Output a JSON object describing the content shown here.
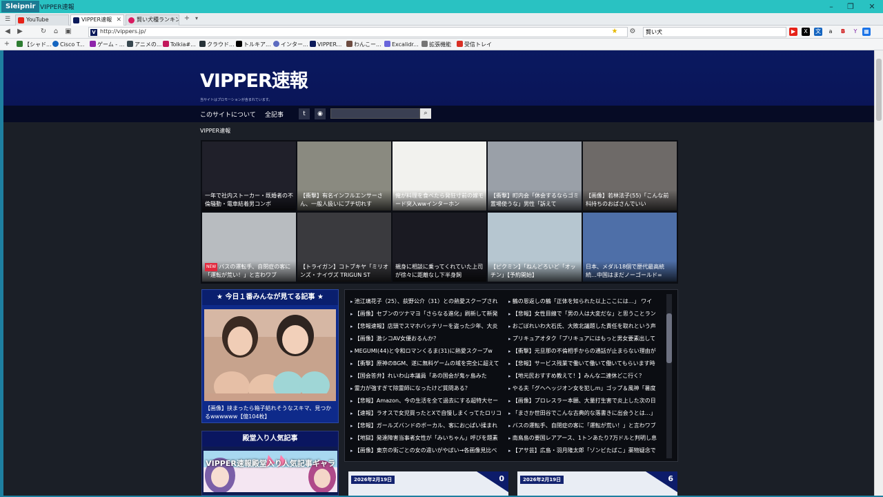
{
  "window": {
    "app_name": "Sleipnir",
    "title": "VIPPER速報"
  },
  "tabs": [
    {
      "label": "YouTube",
      "color": "#e62117"
    },
    {
      "label": "VIPPER速報",
      "color": "#0b1a5a"
    },
    {
      "label": "賢い犬種ランキン...",
      "color": "#d81b60"
    }
  ],
  "address": {
    "url": "http://vippers.jp/",
    "search_value": "賢い犬"
  },
  "bookmarks": [
    {
      "label": "【シャド...",
      "color": "#2e7d32"
    },
    {
      "label": "Cisco T...",
      "color": "#1565c0"
    },
    {
      "label": "ゲーム - ...",
      "color": "#8e24aa"
    },
    {
      "label": "アニメの...",
      "color": "#37474f"
    },
    {
      "label": "Tolkia#...",
      "color": "#c2185b"
    },
    {
      "label": "クラウド...",
      "color": "#263238"
    },
    {
      "label": "トルキア...",
      "color": "#000000"
    },
    {
      "label": "インター...",
      "color": "#5c6bc0"
    },
    {
      "label": "VIPPER...",
      "color": "#0b1a5a"
    },
    {
      "label": "わんこー...",
      "color": "#6d4c41"
    },
    {
      "label": "Excalidr...",
      "color": "#6965db"
    },
    {
      "label": "拡張機能",
      "color": "#757575"
    },
    {
      "label": "受信トレイ",
      "color": "#d93025"
    }
  ],
  "site": {
    "title": "VIPPER速報",
    "promo_note": "当サイトはプロモーションが含まれています。",
    "menu": [
      "このサイトについて",
      "全記事"
    ],
    "breadcrumb": "VIPPER速報"
  },
  "grid": [
    {
      "caption": "一年で社内ストーカー・既婚者の不倫騒動・電車結着男コンボ",
      "bg": "#20202a",
      "new": false
    },
    {
      "caption": "【衝撃】有名インフルエンサーさん、一般人扱いにブチ切れす",
      "bg": "#8a8a80",
      "new": false
    },
    {
      "caption": "俺が料理を食べたら発狂寸前の嫁モード突入wwインターホン",
      "bg": "#f2f2ee",
      "new": false
    },
    {
      "caption": "【衝撃】町内会「休会するならゴミ置場使うな」男性「訴えて",
      "bg": "#9aa0a8",
      "new": false
    },
    {
      "caption": "【画像】若林法子(55)「こんな前科持ちのおばさんでいい",
      "bg": "#6e6a68",
      "new": false
    },
    {
      "caption": "バスの運転手、自閉症の客に「運転が荒い！」と言わワブ",
      "bg": "#b8bcc0",
      "new": true
    },
    {
      "caption": "【トライガン】コトブキヤ「ミリオンズ・ナイヴズ TRIGUN ST",
      "bg": "#3a3a3e",
      "new": false
    },
    {
      "caption": "親身に相談に乗ってくれていた上司が徐々に距離なし下半身飼",
      "bg": "#1a1a22",
      "new": false
    },
    {
      "caption": "【ピクミン】「ねんどろいど「オッチン」【予約開始】",
      "bg": "#b6c6d0",
      "new": false
    },
    {
      "caption": "日本、メダル18個で歴代最高統続…中国はまだノーゴールド=",
      "bg": "#4e6fa8",
      "new": false
    }
  ],
  "popular": {
    "heading": "★ 今日１番みんなが見てる記事 ★",
    "caption": "【画像】挟まったら箱子結れそうなスキマ、見つかるwwwwww【億104枚】"
  },
  "hall_of_fame": {
    "heading": "殿堂入り人気記事",
    "banner": "VIPPER速報殿堂入り人気記事ギャラ"
  },
  "headlines_left": [
    "池江璃花子（25）、荻野公介（31）との熱愛スクープされ",
    "【画像】セブンのツナマヨ「さらなる進化」刷新して新発",
    "【悲報速報】店頭でスマホバッテリーを盗った少年、大炎",
    "【画像】激シコAV女優おるんか？",
    "MEGUMI(44)と令和ロマンくるま(31)に熱愛スクープw",
    "【衝撃】原神のBGM、遂に無料ゲームの域を完全に超えて",
    "【国会答弁】れいわ山本議員「あの国会が鬼ヶ島みた",
    "霊力が強すぎて除霊師になったけど質問ある？",
    "【悲報】Amazon、今の生活を全て過去にする超特大セー",
    "【速報】ラオスで女児買ったとXで自慢しまくってたロリコ",
    "【悲報】ガールズバンドのボーカル、客にお○ぱい揉まれ",
    "【地獄】発達障害当事者女性が「みいちゃん」呼びを題素",
    "【画像】東京の街ごとの女の違いがやばい→各画像見比べ"
  ],
  "headlines_right": [
    "鶴の恩返しの鶴「正体を知られた以上ここには…」 ワイ",
    "【悲報】女性目線で「男の人は大変だな」と思うことラン",
    "おごぼれいわ大石氏、大敗北議題した責任を取れという声",
    "プリキュアオタク「プリキュアにはもっと男女要素出して",
    "【衝撃】元旦那の不倫相手からの通話が止まらない理由が",
    "【悲報】サービス残業で働いて働いて働いてもらいます時",
    "【地元民おすすめ教えて！】みんな二連休どこ行く？",
    "やる夫「グヘヘッジオン女を犯しm」ゴップ＆風神「暑度",
    "【画像】プロレスラー本願、大量打生害で炎上した次の日",
    "「まさか世田谷でこんな古典的な落書きに出会うとは…」",
    "バスの運転手、自閉症の客に「運転が荒い！」と言わワブ",
    "南鳥島の要国レアアース、1トンあたり7万ドルと判明し息",
    "【アサ芸】広島・羽月隆太郎「ゾンビたばこ」薬物疑念で"
  ],
  "cards": [
    {
      "date": "2026年2月19日",
      "count": "0"
    },
    {
      "date": "2026年2月19日",
      "count": "6"
    }
  ]
}
